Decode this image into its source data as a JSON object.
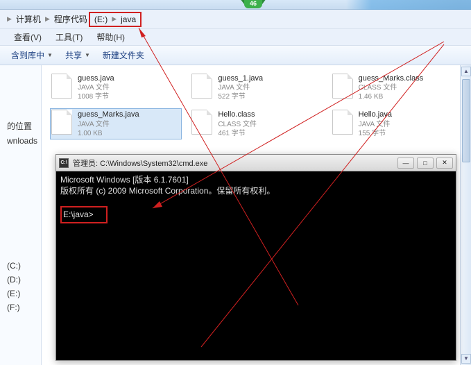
{
  "tabs": {
    "badge": "46"
  },
  "breadcrumb": {
    "items": [
      "计算机",
      "程序代码",
      "(E:)",
      "java"
    ],
    "highlight_start": 2
  },
  "menu": {
    "view": "查看(V)",
    "tools": "工具(T)",
    "help": "帮助(H)"
  },
  "toolbar": {
    "include": "含到库中",
    "share": "共享",
    "new_folder": "新建文件夹"
  },
  "sidebar": {
    "recent": "的位置",
    "downloads": "wnloads",
    "drives": [
      "(C:)",
      "(D:)",
      "(E:)",
      "(F:)"
    ]
  },
  "files": [
    {
      "name": "guess.java",
      "type": "JAVA 文件",
      "size": "1008 字节",
      "selected": false
    },
    {
      "name": "guess_1.java",
      "type": "JAVA 文件",
      "size": "522 字节",
      "selected": false
    },
    {
      "name": "guess_Marks.class",
      "type": "CLASS 文件",
      "size": "1.46 KB",
      "selected": false
    },
    {
      "name": "guess_Marks.java",
      "type": "JAVA 文件",
      "size": "1.00 KB",
      "selected": true
    },
    {
      "name": "Hello.class",
      "type": "CLASS 文件",
      "size": "461 字节",
      "selected": false
    },
    {
      "name": "Hello.java",
      "type": "JAVA 文件",
      "size": "155 字节",
      "selected": false
    }
  ],
  "cmd": {
    "icon": "C:\\",
    "title": "管理员: C:\\Windows\\System32\\cmd.exe",
    "line1": "Microsoft Windows [版本 6.1.7601]",
    "line2": "版权所有 (c) 2009 Microsoft Corporation。保留所有权利。",
    "prompt": "E:\\java>",
    "btn_min": "—",
    "btn_max": "□",
    "btn_close": "✕"
  }
}
